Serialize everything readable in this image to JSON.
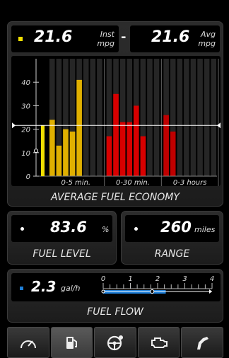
{
  "economy": {
    "inst_value": "21.6",
    "inst_label": "Inst",
    "inst_unit": "mpg",
    "separator": "-",
    "avg_value": "21.6",
    "avg_label": "Avg",
    "avg_unit": "mpg",
    "caption": "AVERAGE FUEL ECONOMY",
    "marker_color": "#f2e000"
  },
  "chart_data": {
    "type": "bar",
    "ylim": [
      0,
      50
    ],
    "yticks": [
      0,
      10,
      20,
      30,
      40
    ],
    "reference_line": 21.6,
    "current_value": 21.6,
    "groups": [
      {
        "label": "0-5 min.",
        "color": "#e0b000",
        "values": [
          24,
          13,
          20,
          19,
          41
        ]
      },
      {
        "label": "0-30 min.",
        "color": "#d80000",
        "values": [
          17,
          35,
          23,
          23,
          30,
          17
        ]
      },
      {
        "label": "0-3 hours",
        "color": "#c00000",
        "values": [
          26,
          19
        ]
      }
    ]
  },
  "fuel_level": {
    "value": "83.6",
    "unit": "%",
    "caption": "FUEL LEVEL"
  },
  "range": {
    "value": "260",
    "unit": "miles",
    "caption": "RANGE"
  },
  "fuel_flow": {
    "value": "2.3",
    "unit": "gal/h",
    "caption": "FUEL FLOW",
    "scale_labels": [
      "0",
      "1",
      "2",
      "3",
      "4"
    ],
    "scale_max": 4,
    "current": 2.3,
    "average": 1.8,
    "marker_color": "#1e7fd8"
  },
  "tabs": [
    {
      "name": "tab-gauges",
      "icon": "speedometer-icon",
      "active": false
    },
    {
      "name": "tab-fuel",
      "icon": "fuel-pump-icon",
      "active": true
    },
    {
      "name": "tab-trip",
      "icon": "steering-wheel-icon",
      "active": false
    },
    {
      "name": "tab-engine",
      "icon": "engine-icon",
      "active": false
    },
    {
      "name": "tab-refuel",
      "icon": "fuel-nozzle-icon",
      "active": false
    }
  ]
}
